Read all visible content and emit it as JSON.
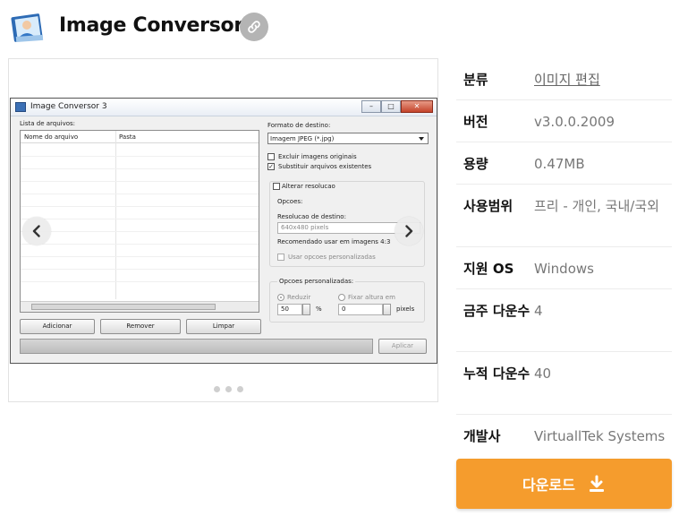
{
  "header": {
    "title": "Image Conversor"
  },
  "screenshot": {
    "window_title": "Image Conversor 3",
    "file_list_label": "Lista de arquivos:",
    "columns": [
      "Nome do arquivo",
      "Pasta"
    ],
    "buttons": [
      "Adicionar",
      "Remover",
      "Limpar"
    ],
    "apply_label": "Aplicar",
    "format_label": "Formato de destino:",
    "format_value": "Imagem JPEG (*.jpg)",
    "check_exclude": "Excluir imagens originais",
    "check_replace": "Substituir arquivos existentes",
    "check_resolution": "Alterar resolucao",
    "options_label": "Opcoes:",
    "resolution_label": "Resolucao de destino:",
    "resolution_value": "640x480 pixels",
    "recommended": "Recomendado usar em imagens 4:3",
    "custom_options_check": "Usar opcoes personalizadas",
    "custom_options_label": "Opcoes personalizadas:",
    "reduce_label": "Reduzir",
    "fix_height_label": "Fixar altura em",
    "reduce_value": "50",
    "percent": "%",
    "height_value": "0",
    "pixels": "pixels"
  },
  "info": {
    "rows": [
      {
        "key": "분류",
        "value": "이미지 편집"
      },
      {
        "key": "버전",
        "value": "v3.0.0.2009"
      },
      {
        "key": "용량",
        "value": "0.47MB"
      },
      {
        "key": "사용범위",
        "value": "프리 - 개인, 국내/국외"
      },
      {
        "key": "지원 OS",
        "value": "Windows"
      },
      {
        "key": "금주 다운수",
        "value": "4"
      },
      {
        "key": "누적 다운수",
        "value": "40"
      },
      {
        "key": "개발사",
        "value": "VirtuallTek Systems"
      }
    ]
  },
  "download": {
    "label": "다운로드"
  },
  "colors": {
    "accent": "#f59c2d",
    "link_button": "#b4b4b4"
  },
  "icons": [
    "app-photo-icon",
    "link-icon",
    "chevron-left-icon",
    "chevron-right-icon",
    "download-icon"
  ]
}
